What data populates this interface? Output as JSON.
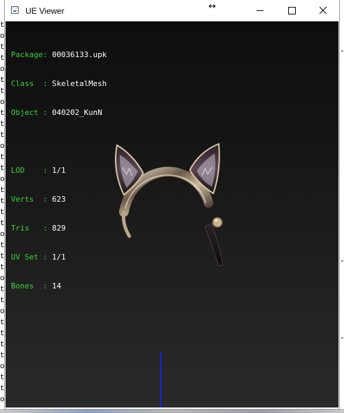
{
  "window": {
    "title": "UE Viewer",
    "controls": {
      "minimize_icon": "minimize-icon",
      "maximize_icon": "maximize-icon",
      "close_icon": "close-icon",
      "resize_icon": "resize-horizontal-icon",
      "resize_glyph": "↔"
    }
  },
  "info": {
    "package": {
      "label": "Package",
      "sep": ": ",
      "value": "00036133.upk"
    },
    "class": {
      "label": "Class  ",
      "sep": ": ",
      "value": "SkeletalMesh"
    },
    "object": {
      "label": "Object ",
      "sep": ": ",
      "value": "040202_KunN"
    },
    "lod": {
      "label": "LOD    ",
      "sep": ": ",
      "value": "1/1"
    },
    "verts": {
      "label": "Verts  ",
      "sep": ": ",
      "value": "623"
    },
    "tris": {
      "label": "Tris   ",
      "sep": ": ",
      "value": "829"
    },
    "uvset": {
      "label": "UV Set ",
      "sep": ": ",
      "value": "1/1"
    },
    "bones": {
      "label": "Bones  ",
      "sep": ": ",
      "value": "14"
    }
  },
  "colors": {
    "label_green": "#3fd13f",
    "value_white": "#ffffff",
    "axis_blue": "#1a22d8"
  },
  "background_left_chars": [
    "t",
    "o",
    "t",
    "t",
    "o",
    "t",
    "t",
    "o",
    "t",
    "t",
    "t",
    "o",
    "t",
    "t",
    "o",
    "t",
    "t",
    "t",
    "t",
    "o",
    "t",
    "t",
    "t",
    "o",
    "t",
    "t",
    "o",
    "t",
    "t",
    "t",
    "t",
    "o",
    "t",
    "t",
    "o"
  ]
}
